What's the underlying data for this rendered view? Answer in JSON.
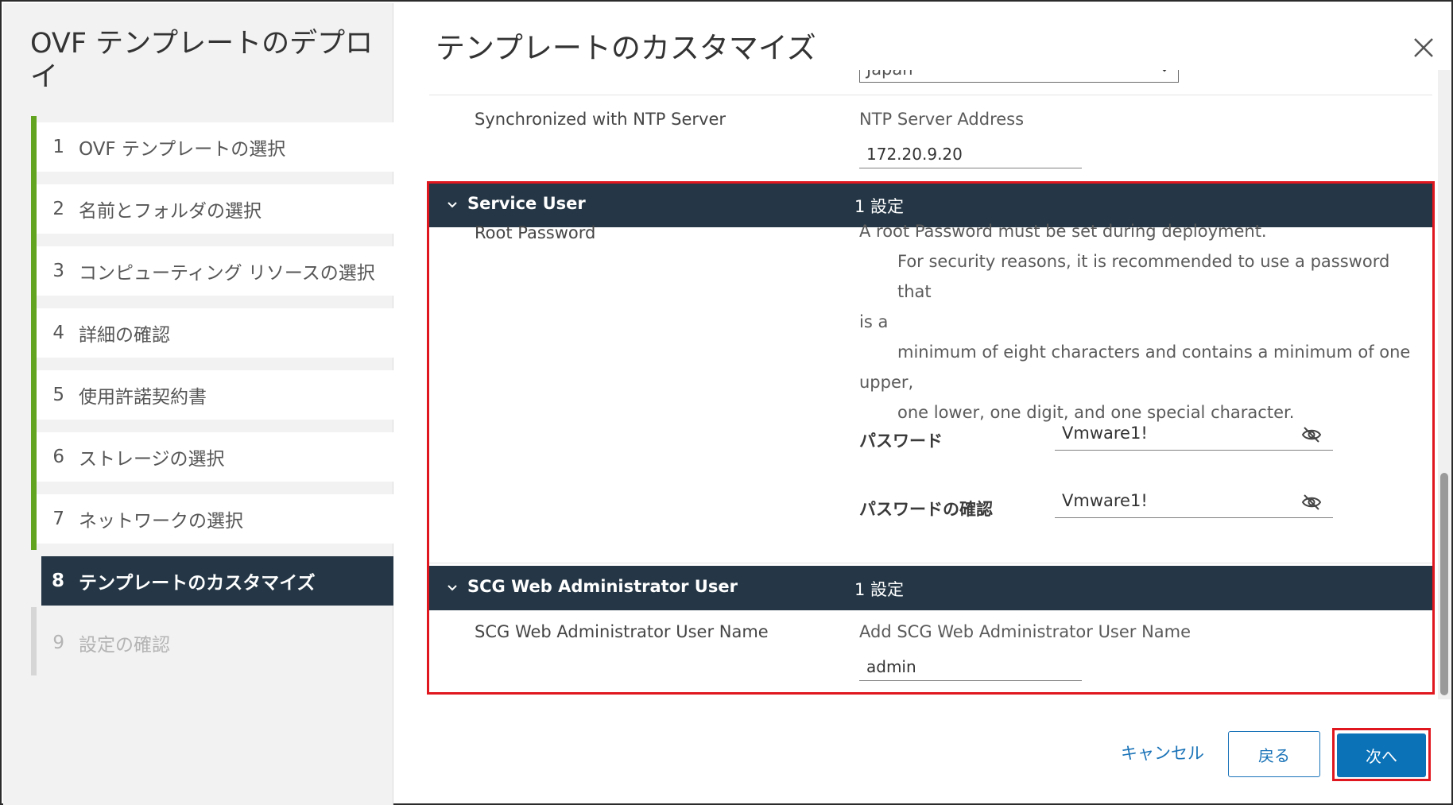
{
  "wizard": {
    "title": "OVF テンプレートのデプロイ",
    "steps": [
      {
        "num": "1",
        "label": "OVF テンプレートの選択",
        "state": "completed"
      },
      {
        "num": "2",
        "label": "名前とフォルダの選択",
        "state": "completed"
      },
      {
        "num": "3",
        "label": "コンピューティング リソースの選択",
        "state": "completed"
      },
      {
        "num": "4",
        "label": "詳細の確認",
        "state": "completed"
      },
      {
        "num": "5",
        "label": "使用許諾契約書",
        "state": "completed"
      },
      {
        "num": "6",
        "label": "ストレージの選択",
        "state": "completed"
      },
      {
        "num": "7",
        "label": "ネットワークの選択",
        "state": "completed"
      },
      {
        "num": "8",
        "label": "テンプレートのカスタマイズ",
        "state": "active"
      },
      {
        "num": "9",
        "label": "設定の確認",
        "state": "disabled"
      }
    ]
  },
  "page": {
    "title": "テンプレートのカスタマイズ",
    "timezone_select_value": "Japan",
    "ntp": {
      "label": "Synchronized with NTP Server",
      "description": "NTP Server Address",
      "value": "172.20.9.20"
    },
    "service_user": {
      "header": "Service User",
      "count": "1 設定",
      "root_password_label": "Root Password",
      "description_lines": [
        "A root Password must be set during deployment.",
        "For security reasons, it is recommended to use a password that",
        "is a",
        "minimum of eight characters and contains a minimum of one",
        "upper,",
        "one lower, one digit, and one special character."
      ],
      "password_label": "パスワード",
      "password_value": "Vmware1!",
      "confirm_label": "パスワードの確認",
      "confirm_value": "Vmware1!"
    },
    "scg_admin": {
      "header": "SCG Web Administrator User",
      "count": "1 設定",
      "username_label": "SCG Web Administrator User Name",
      "description": "Add SCG Web Administrator User Name",
      "value": "admin"
    }
  },
  "footer": {
    "cancel": "キャンセル",
    "back": "戻る",
    "next": "次へ"
  },
  "colors": {
    "header_dark": "#253746",
    "step_done_bar": "#62a420",
    "primary": "#0b72b8",
    "highlight": "#e0171f"
  }
}
